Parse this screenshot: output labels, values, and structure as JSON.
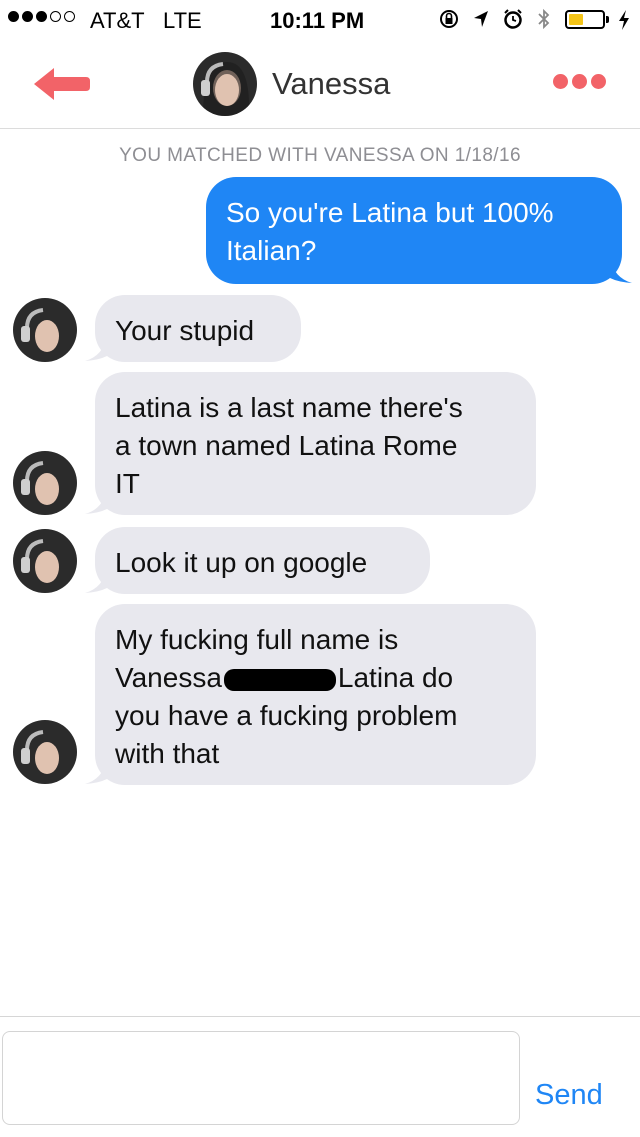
{
  "status_bar": {
    "carrier": "AT&T",
    "network": "LTE",
    "time": "10:11 PM",
    "signal_bars_filled": 3,
    "signal_bars_total": 5,
    "battery_level": 0.45,
    "battery_color": "#f5c518"
  },
  "header": {
    "contact_name": "Vanessa",
    "back_icon": "arrow-left-icon",
    "more_icon": "ellipsis-icon",
    "accent_color": "#f26368"
  },
  "match_notice": "YOU MATCHED WITH VANESSA ON 1/18/16",
  "messages": [
    {
      "from": "me",
      "lines": [
        "So you're Latina but 100%",
        "Italian?"
      ]
    },
    {
      "from": "them",
      "lines": [
        "Your stupid"
      ]
    },
    {
      "from": "them",
      "lines": [
        "Latina is a last name there's",
        "a town named Latina Rome",
        "IT"
      ]
    },
    {
      "from": "them",
      "lines": [
        "Look it up on google"
      ]
    },
    {
      "from": "them",
      "lines": [
        "My fucking full name is",
        "Vanessa",
        "Latina do",
        "you have a fucking problem",
        "with that"
      ]
    }
  ],
  "input": {
    "value": "",
    "placeholder": "",
    "send_label": "Send"
  },
  "colors": {
    "sent_bubble": "#1f86f5",
    "received_bubble": "#e8e8ee",
    "notice_text": "#8e8e93"
  }
}
